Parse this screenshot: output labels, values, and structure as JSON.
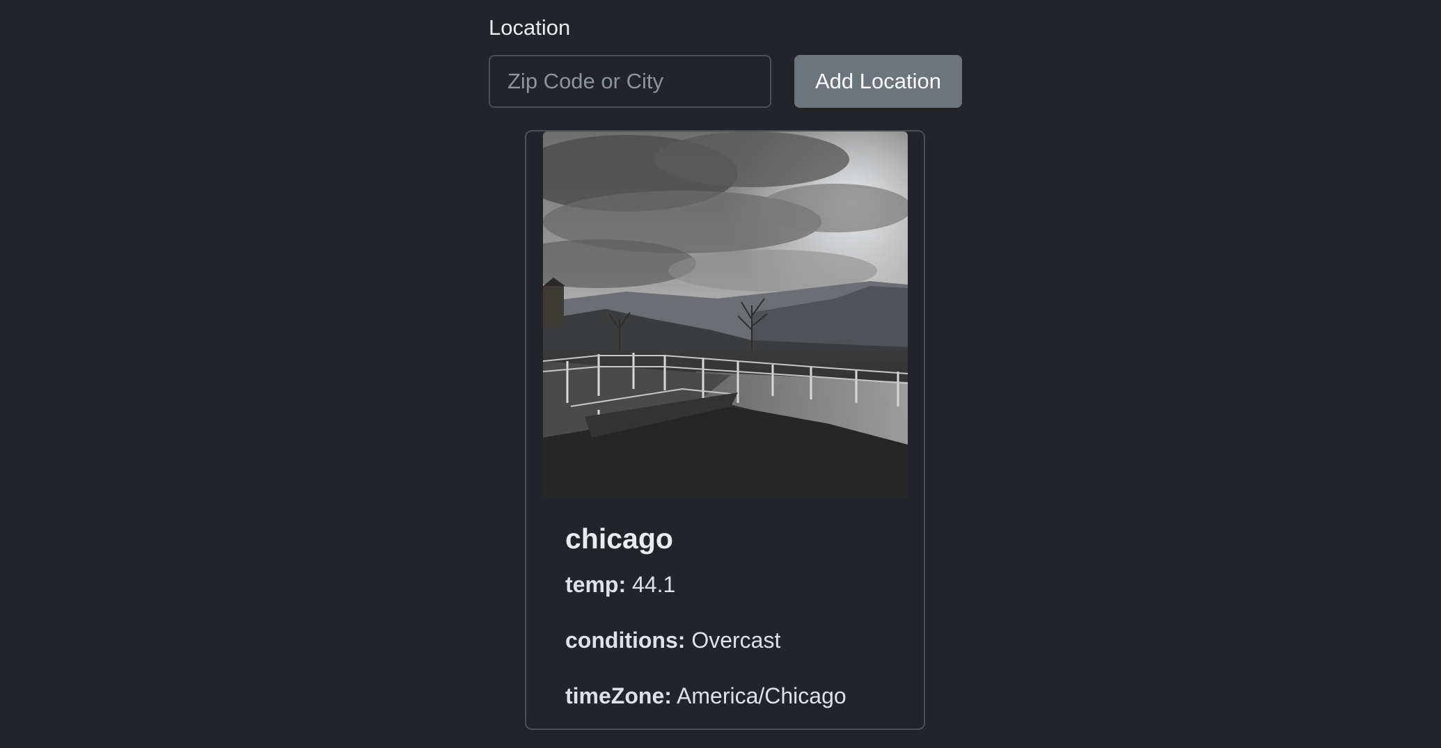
{
  "form": {
    "label": "Location",
    "input_placeholder": "Zip Code or City",
    "input_value": "",
    "add_button_label": "Add Location"
  },
  "card": {
    "image": "overcast-landscape-photo",
    "title": "chicago",
    "fields": [
      {
        "label": "temp:",
        "value": "44.1"
      },
      {
        "label": "conditions:",
        "value": "Overcast"
      },
      {
        "label": "timeZone:",
        "value": "America/Chicago"
      }
    ]
  },
  "colors": {
    "background": "#212529",
    "button": "#6c757d",
    "border": "#495057"
  }
}
